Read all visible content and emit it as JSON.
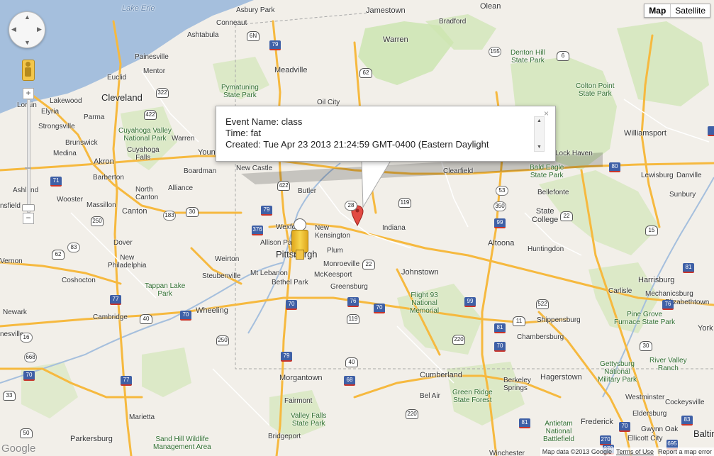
{
  "map": {
    "type_buttons": [
      {
        "label": "Map",
        "active": true
      },
      {
        "label": "Satellite",
        "active": false
      }
    ],
    "info_window": {
      "lines": [
        "Event Name: class",
        "Time: fat",
        "Created: Tue Apr 23 2013 21:24:59 GMT-0400 (Eastern Daylight"
      ],
      "close": "×"
    },
    "footer": {
      "data": "Map data ©2013 Google",
      "terms": "Terms of Use",
      "report": "Report a map error"
    },
    "logo": "Google",
    "icons": {
      "pan": "pan-control-icon",
      "pegman": "street-view-pegman-icon",
      "marker": "red-map-pin-icon",
      "person": "pegman-dropped-icon"
    },
    "colors": {
      "water": "#a5bfdd",
      "land": "#f2efe9",
      "park": "#cde5b1",
      "highway": "#f6b93f",
      "marker": "#e24a43"
    },
    "labels": {
      "lake_erie": "Lake Erie",
      "olean": "Olean",
      "jamestown": "Jamestown",
      "asbury_park": "Asbury Park",
      "conneaut": "Conneaut",
      "ashtabula": "Ashtabula",
      "bradford": "Bradford",
      "warren": "Warren",
      "denton_hill": "Denton Hill\nState Park",
      "painesville": "Painesville",
      "mentor": "Mentor",
      "meadville": "Meadville",
      "euclid": "Euclid",
      "pymatuning": "Pymatuning\nState Park",
      "colton_point": "Colton Point\nState Park",
      "cleveland": "Cleveland",
      "lakewood": "Lakewood",
      "lorain": "Lorain",
      "elyria": "Elyria",
      "parma": "Parma",
      "oil_city": "Oil City",
      "strongsville": "Strongsville",
      "cuyahoga_valley": "Cuyahoga Valley\nNational Park",
      "williamsport": "Williamsport",
      "brunswick": "Brunswick",
      "warren_oh": "Warren",
      "cuyahoga_falls": "Cuyahoga\nFalls",
      "medina": "Medina",
      "akron": "Akron",
      "youngstown": "Youngstown",
      "lock_haven": "Lock Haven",
      "new_castle": "New Castle",
      "boardman": "Boardman",
      "clearfield": "Clearfield",
      "bald_eagle": "Bald Eagle\nState Park",
      "lewisburg": "Lewisburg",
      "danville": "Danville",
      "barberton": "Barberton",
      "north_canton": "North\nCanton",
      "alliance": "Alliance",
      "butler": "Butler",
      "ashland": "Ashland",
      "wooster": "Wooster",
      "massillon": "Massillon",
      "canton": "Canton",
      "bellefonte": "Bellefonte",
      "sunbury": "Sunbury",
      "mansfield": "nsfield",
      "state_college": "State\nCollege",
      "indiana": "Indiana",
      "new_kensington": "New\nKensington",
      "wexford": "Wexford",
      "allison_park": "Allison Park",
      "pittsburgh": "Pittsburgh",
      "plum": "Plum",
      "altoona": "Altoona",
      "huntingdon": "Huntingdon",
      "dover": "Dover",
      "new_philadelphia": "New\nPhiladelphia",
      "weirton": "Weirton",
      "monroeville": "Monroeville",
      "mt_lebanon": "Mt Lebanon",
      "mckeesport": "McKeesport",
      "johnstown": "Johnstown",
      "mount_vernon": "Vernon",
      "coshocton": "Coshocton",
      "steubenville": "Steubenville",
      "bethel_park": "Bethel Park",
      "greensburg": "Greensburg",
      "harrisburg": "Harrisburg",
      "tappan_lake": "Tappan Lake\nPark",
      "carlisle": "Carlisle",
      "mechanicsburg": "Mechanicsburg",
      "flight93": "Flight 93\nNational\nMemorial",
      "elizabethtown": "Elizabethtown",
      "newark": "Newark",
      "cambridge": "Cambridge",
      "wheeling": "Wheeling",
      "pine_grove": "Pine Grove\nFurnace State Park",
      "shippensburg": "Shippensburg",
      "chambersburg": "Chambersburg",
      "york": "York",
      "river_valley": "River Valley\nRanch",
      "gettysburg": "Gettysburg\nNational\nMilitary Park",
      "zanesville": "nesville",
      "morgantown": "Morgantown",
      "cumberland": "Cumberland",
      "hagerstown": "Hagerstown",
      "berkeley_springs": "Berkeley\nSprings",
      "green_ridge": "Green Ridge\nState Forest",
      "westminster": "Westminster",
      "fairmont": "Fairmont",
      "bel_air": "Bel Air",
      "eldersburg": "Eldersburg",
      "cockeysville": "Cockeysville",
      "marietta": "Marietta",
      "valley_falls": "Valley Falls\nState Park",
      "frederick": "Frederick",
      "antietam": "Antietam\nNational\nBattlefield",
      "parkersburg": "Parkersburg",
      "sand_hill": "Sand Hill Wildlife\nManagement Area",
      "bridgeport": "Bridgeport",
      "ellicott_city": "Ellicott City",
      "gwynn_oak": "Gwynn Oak",
      "baltimore": "Baltim",
      "winchester": "Winchester"
    },
    "shields": {
      "i79_n": "79",
      "i79_mid": "79",
      "i79_s": "79",
      "i80_e": "80",
      "i80_w": "80",
      "i99": "99",
      "i376": "376",
      "i76": "76",
      "i76_e": "76",
      "i70_w": "70",
      "i70_c": "70",
      "i70_e": "70",
      "i71": "71",
      "i77": "77",
      "i77_s": "77",
      "i81": "81",
      "i81_s": "81",
      "i68": "68",
      "i83": "83",
      "i76_w": "76",
      "i270": "270",
      "i695": "695",
      "i95": "95",
      "i470": "470",
      "us6": "6",
      "us6n": "6N",
      "us62": "62",
      "us322": "322",
      "us422": "422",
      "us422_w": "422",
      "us22": "22",
      "us22_e": "22",
      "us30": "30",
      "us219": "219",
      "us119": "119",
      "us119_s": "119",
      "us250": "250",
      "us250_s": "250",
      "us40": "40",
      "us40_e": "40",
      "us15": "15",
      "us11": "11",
      "us522": "522",
      "us220": "220",
      "us50": "50",
      "us33": "33",
      "us62_w": "62",
      "us224": "224",
      "sr155": "155",
      "sr28": "28",
      "sr350": "350",
      "sr53": "53",
      "sr183": "183",
      "sr83": "83",
      "sr93": "93",
      "sr16": "16",
      "sr668": "668",
      "sr711": "711",
      "sr97": "97"
    }
  }
}
